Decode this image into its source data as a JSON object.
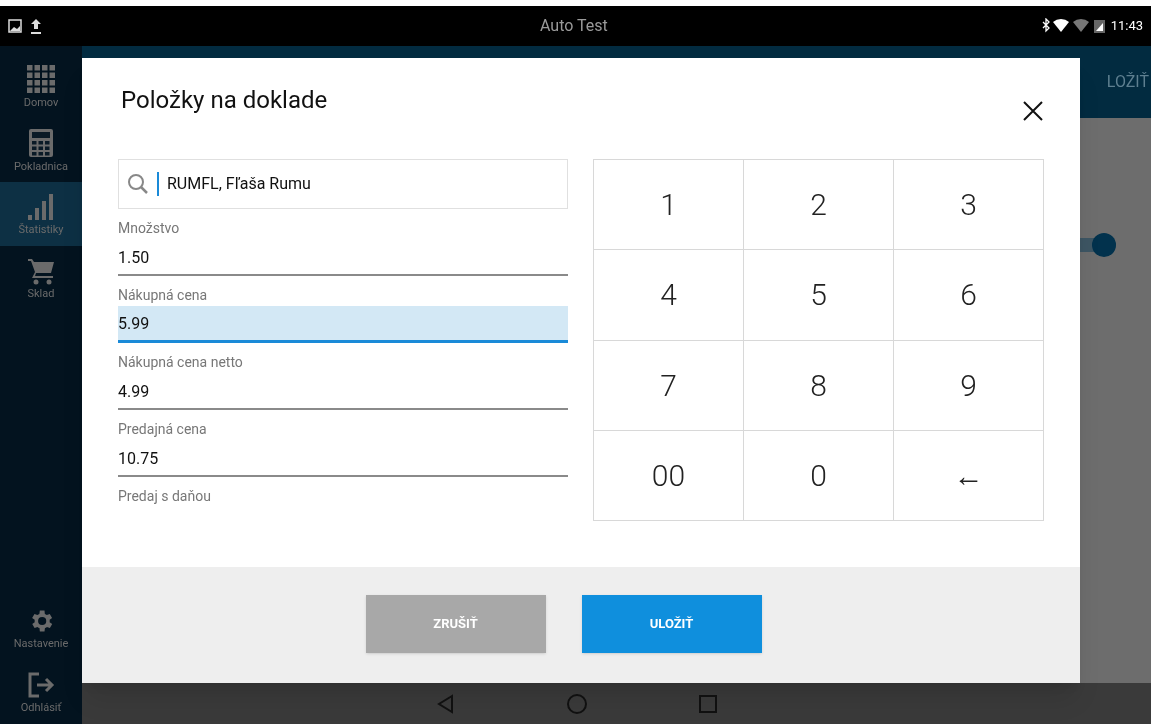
{
  "status_bar": {
    "title": "Auto Test",
    "time": "11:43"
  },
  "sidebar": {
    "items": [
      {
        "label": "Domov",
        "kind": "grid",
        "selected": false
      },
      {
        "label": "Pokladnica",
        "kind": "calculator",
        "selected": false
      },
      {
        "label": "Štatistiky",
        "kind": "bars",
        "selected": true
      },
      {
        "label": "Sklad",
        "kind": "cart",
        "selected": false
      }
    ],
    "bottom_items": [
      {
        "label": "Nastavenie",
        "kind": "gear",
        "selected": false
      },
      {
        "label": "Odhlásiť",
        "kind": "logout",
        "selected": false
      }
    ]
  },
  "app_bar": {
    "action": "LOŽIŤ"
  },
  "background_switch": {
    "on": true
  },
  "dialog": {
    "title": "Položky na doklade",
    "search": {
      "value": "RUMFL, Fľaša Rumu"
    },
    "fields": [
      {
        "label": "Množstvo",
        "value": "1.50",
        "selected": false
      },
      {
        "label": "Nákupná cena",
        "value": "5.99",
        "selected": true
      },
      {
        "label": "Nákupná cena netto",
        "value": "4.99",
        "selected": false
      },
      {
        "label": "Predajná cena",
        "value": "10.75",
        "selected": false
      },
      {
        "label": "Predaj s daňou",
        "selected": false
      }
    ],
    "keypad": [
      "1",
      "2",
      "3",
      "4",
      "5",
      "6",
      "7",
      "8",
      "9",
      "00",
      "0",
      "←"
    ],
    "buttons": [
      {
        "label": "ZRUŠIŤ",
        "kind": "secondary"
      },
      {
        "label": "ULOŽIŤ",
        "kind": "primary"
      }
    ]
  }
}
